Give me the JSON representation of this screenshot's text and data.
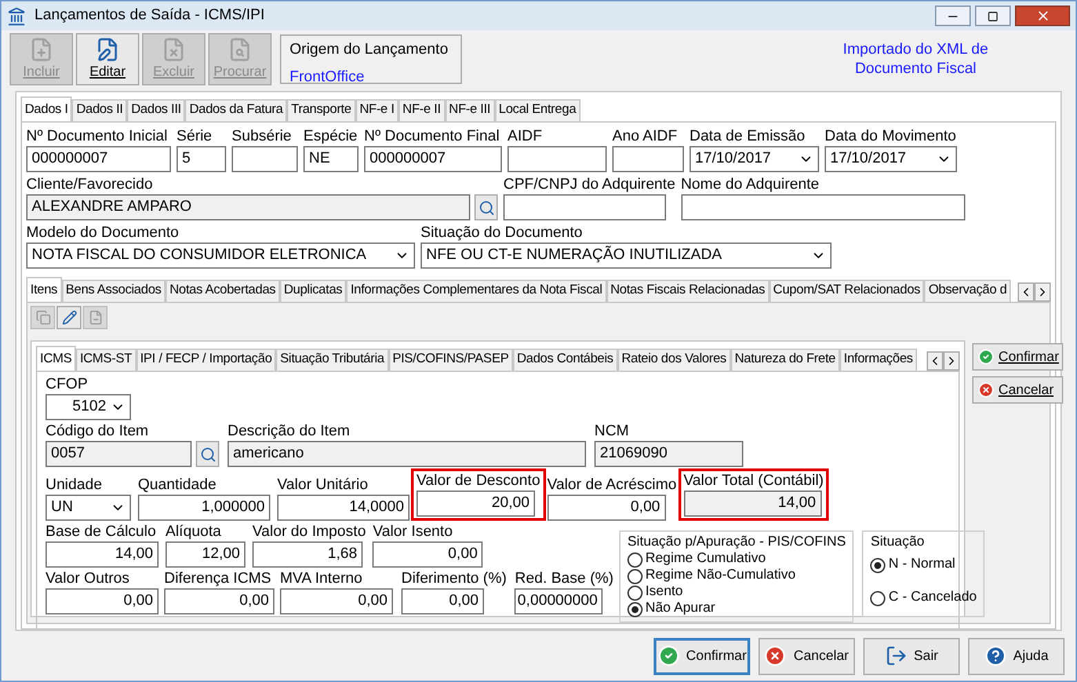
{
  "window": {
    "title": "Lançamentos de Saída - ICMS/IPI"
  },
  "toolbar": {
    "buttons": [
      {
        "label": "Incluir",
        "disabled": true
      },
      {
        "label": "Editar",
        "disabled": false
      },
      {
        "label": "Excluir",
        "disabled": true
      },
      {
        "label": "Procurar",
        "disabled": true
      }
    ]
  },
  "origin": {
    "label": "Origem do Lançamento",
    "value": "FrontOffice"
  },
  "import_note": "Importado do XML de Documento Fiscal",
  "main_tabs": [
    {
      "label": "Dados I",
      "selected": true
    },
    {
      "label": "Dados II",
      "selected": false
    },
    {
      "label": "Dados III",
      "selected": false
    },
    {
      "label": "Dados da Fatura",
      "selected": false
    },
    {
      "label": "Transporte",
      "selected": false
    },
    {
      "label": "NF-e I",
      "selected": false
    },
    {
      "label": "NF-e II",
      "selected": false
    },
    {
      "label": "NF-e III",
      "selected": false
    },
    {
      "label": "Local Entrega",
      "selected": false
    }
  ],
  "header_rows": [
    [
      {
        "label": "Nº Documento Inicial",
        "value": "000000007",
        "kind": "text"
      },
      {
        "label": "Série",
        "value": "5",
        "kind": "text"
      },
      {
        "label": "Subsérie",
        "kind": "text"
      },
      {
        "label": "Espécie",
        "value": "NE",
        "kind": "text"
      },
      {
        "label": "Nº Documento Final",
        "value": "000000007",
        "kind": "text"
      },
      {
        "label": "AIDF",
        "kind": "text"
      },
      {
        "label": "Ano AIDF",
        "kind": "text"
      },
      {
        "label": "Data de Emissão",
        "value": "17/10/2017",
        "kind": "select"
      },
      {
        "label": "Data do Movimento",
        "value": "17/10/2017",
        "kind": "select"
      }
    ],
    [
      {
        "label": "Cliente/Favorecido",
        "value": "ALEXANDRE AMPARO",
        "kind": "text",
        "readonly": true,
        "lookup": true
      },
      {
        "label": "CPF/CNPJ do Adquirente",
        "kind": "text"
      },
      {
        "label": "Nome do Adquirente",
        "kind": "text"
      }
    ],
    [
      {
        "label": "Modelo do Documento",
        "value": "NOTA FISCAL DO CONSUMIDOR ELETRONICA",
        "kind": "select"
      },
      {
        "label": "Situação do Documento",
        "value": "NFE OU CT-E NUMERAÇÃO INUTILIZADA",
        "kind": "select"
      }
    ]
  ],
  "detail_tabs": [
    {
      "label": "Itens",
      "selected": true
    },
    {
      "label": "Bens Associados",
      "selected": false
    },
    {
      "label": "Notas Acobertadas",
      "selected": false
    },
    {
      "label": "Duplicatas",
      "selected": false
    },
    {
      "label": "Informações Complementares da Nota Fiscal",
      "selected": false
    },
    {
      "label": "Notas Fiscais Relacionadas",
      "selected": false
    },
    {
      "label": "Cupom/SAT Relacionados",
      "selected": false
    },
    {
      "label": "Observação d",
      "selected": false
    }
  ],
  "item_tabs": [
    {
      "label": "ICMS",
      "selected": true
    },
    {
      "label": "ICMS-ST",
      "selected": false
    },
    {
      "label": "IPI / FECP / Importação",
      "selected": false
    },
    {
      "label": "Situação Tributária",
      "selected": false
    },
    {
      "label": "PIS/COFINS/PASEP",
      "selected": false
    },
    {
      "label": "Dados Contábeis",
      "selected": false
    },
    {
      "label": "Rateio dos Valores",
      "selected": false
    },
    {
      "label": "Natureza do Frete",
      "selected": false
    },
    {
      "label": "Informações",
      "selected": false
    }
  ],
  "item_rows": [
    [
      {
        "label": "CFOP",
        "value": "5102",
        "kind": "select",
        "right_aligned": true
      }
    ],
    [
      {
        "label": "Código do Item",
        "value": "0057",
        "kind": "text",
        "readonly": true,
        "lookup": true
      },
      {
        "label": "Descrição do Item",
        "value": "americano",
        "kind": "text",
        "readonly": true
      },
      {
        "label": "NCM",
        "value": "21069090",
        "kind": "text",
        "readonly": true
      }
    ],
    [
      {
        "label": "Unidade",
        "value": "UN",
        "kind": "select"
      },
      {
        "label": "Quantidade",
        "value": "1,000000",
        "kind": "number"
      },
      {
        "label": "Valor Unitário",
        "value": "14,0000",
        "kind": "number"
      },
      {
        "label": "Valor de Desconto",
        "value": "20,00",
        "kind": "number",
        "highlighted": true
      },
      {
        "label": "Valor de Acréscimo",
        "value": "0,00",
        "kind": "number"
      },
      {
        "label": "Valor Total (Contábil)",
        "value": "14,00",
        "kind": "number",
        "readonly": true,
        "highlighted": true
      }
    ],
    [
      {
        "label": "Base de Cálculo",
        "value": "14,00",
        "kind": "number"
      },
      {
        "label": "Alíquota",
        "value": "12,00",
        "kind": "number"
      },
      {
        "label": "Valor do Imposto",
        "value": "1,68",
        "kind": "number"
      },
      {
        "label": "Valor Isento",
        "value": "0,00",
        "kind": "number"
      }
    ],
    [
      {
        "label": "Valor Outros",
        "value": "0,00",
        "kind": "number"
      },
      {
        "label": "Diferença ICMS",
        "value": "0,00",
        "kind": "number"
      },
      {
        "label": "MVA Interno",
        "value": "0,00",
        "kind": "number"
      },
      {
        "label": "Diferimento (%)",
        "value": "0,00",
        "kind": "number"
      },
      {
        "label": "Red. Base (%)",
        "value": "0,00000000",
        "kind": "number"
      }
    ]
  ],
  "radio_groups": [
    {
      "title": "Situação p/Apuração - PIS/COFINS",
      "options": [
        {
          "label": "Regime Cumulativo",
          "selected": false
        },
        {
          "label": "Regime Não-Cumulativo",
          "selected": false
        },
        {
          "label": "Isento",
          "selected": false
        },
        {
          "label": "Não Apurar",
          "selected": true
        }
      ]
    },
    {
      "title": "Situação",
      "options": [
        {
          "label": "N - Normal",
          "selected": true
        },
        {
          "label": "C - Cancelado",
          "selected": false
        }
      ]
    }
  ],
  "side_buttons": [
    {
      "label": "Confirmar",
      "kind": "confirm"
    },
    {
      "label": "Cancelar",
      "kind": "cancel"
    }
  ],
  "footer_buttons": [
    {
      "label": "Confirmar",
      "kind": "confirm",
      "focused": true
    },
    {
      "label": "Cancelar",
      "kind": "cancel",
      "focused": false
    },
    {
      "label": "Sair",
      "kind": "exit",
      "focused": false
    },
    {
      "label": "Ajuda",
      "kind": "help",
      "focused": false
    }
  ]
}
